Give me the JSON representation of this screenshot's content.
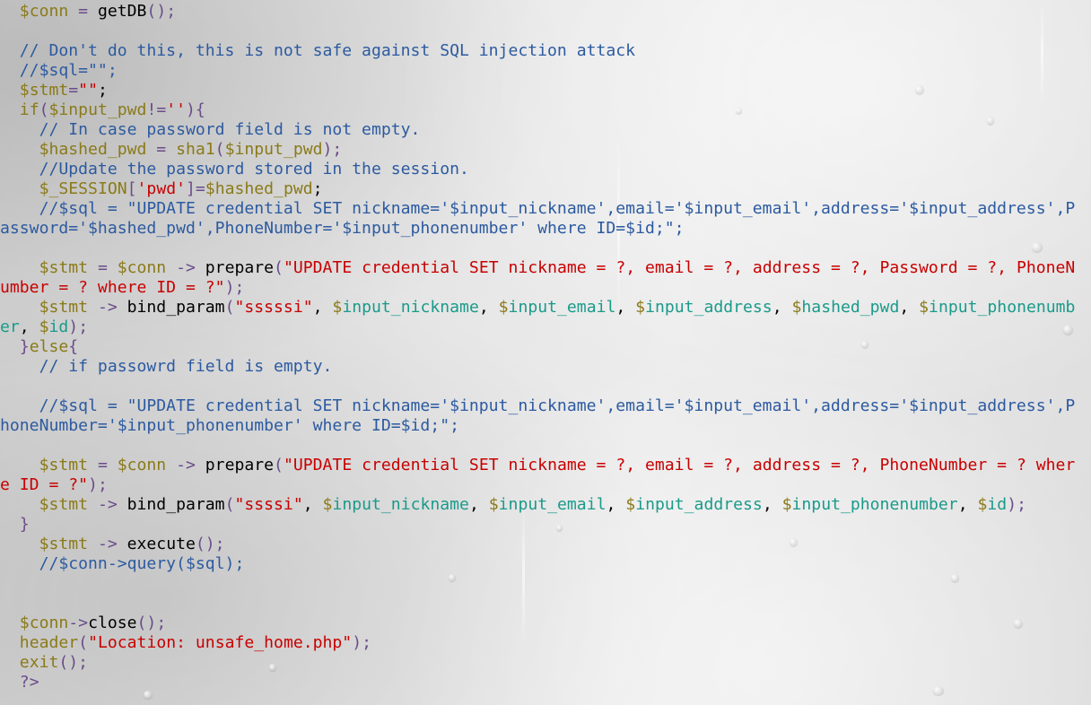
{
  "editor": {
    "lines": [
      [
        {
          "t": "  ",
          "c": ""
        },
        {
          "t": "$conn",
          "c": "var-b"
        },
        {
          "t": " = ",
          "c": "op"
        },
        {
          "t": "getDB",
          "c": "fn"
        },
        {
          "t": "();",
          "c": "op"
        }
      ],
      [],
      [
        {
          "t": "  // Don't do this, this is not safe against SQL injection attack",
          "c": "cm"
        }
      ],
      [
        {
          "t": "  //$sql=\"\";",
          "c": "cm"
        }
      ],
      [
        {
          "t": "  ",
          "c": ""
        },
        {
          "t": "$stmt",
          "c": "var-b"
        },
        {
          "t": "=",
          "c": "op"
        },
        {
          "t": "\"\"",
          "c": "str"
        },
        {
          "t": ";",
          "c": "fn"
        }
      ],
      [
        {
          "t": "  ",
          "c": ""
        },
        {
          "t": "if",
          "c": "kw"
        },
        {
          "t": "(",
          "c": "op"
        },
        {
          "t": "$input_pwd",
          "c": "var-b"
        },
        {
          "t": "!=",
          "c": "op"
        },
        {
          "t": "''",
          "c": "str"
        },
        {
          "t": "){",
          "c": "op"
        }
      ],
      [
        {
          "t": "    // In case password field is not empty.",
          "c": "cm"
        }
      ],
      [
        {
          "t": "    ",
          "c": ""
        },
        {
          "t": "$hashed_pwd",
          "c": "var-b"
        },
        {
          "t": " = ",
          "c": "op"
        },
        {
          "t": "sha1",
          "c": "kw"
        },
        {
          "t": "(",
          "c": "op"
        },
        {
          "t": "$input_pwd",
          "c": "var-b"
        },
        {
          "t": ");",
          "c": "op"
        }
      ],
      [
        {
          "t": "    //Update the password stored in the session.",
          "c": "cm"
        }
      ],
      [
        {
          "t": "    ",
          "c": ""
        },
        {
          "t": "$_SESSION",
          "c": "var-b"
        },
        {
          "t": "[",
          "c": "op"
        },
        {
          "t": "'pwd'",
          "c": "str"
        },
        {
          "t": "]=",
          "c": "op"
        },
        {
          "t": "$hashed_pwd",
          "c": "var-b"
        },
        {
          "t": ";",
          "c": "fn"
        }
      ],
      [
        {
          "t": "    //$sql = \"UPDATE credential SET nickname='$input_nickname',email='$input_email',address='$input_address',P",
          "c": "cm"
        }
      ],
      [
        {
          "t": "assword='$hashed_pwd',PhoneNumber='$input_phonenumber' where ID=$id;\";",
          "c": "cm"
        }
      ],
      [],
      [
        {
          "t": "    ",
          "c": ""
        },
        {
          "t": "$stmt",
          "c": "var-b"
        },
        {
          "t": " = ",
          "c": "op"
        },
        {
          "t": "$conn",
          "c": "var-b"
        },
        {
          "t": " -> ",
          "c": "op"
        },
        {
          "t": "prepare",
          "c": "fn"
        },
        {
          "t": "(",
          "c": "op"
        },
        {
          "t": "\"UPDATE credential SET nickname = ?, email = ?, address = ?, Password = ?, PhoneN",
          "c": "str"
        }
      ],
      [
        {
          "t": "umber = ? where ID = ?\"",
          "c": "str"
        },
        {
          "t": ");",
          "c": "op"
        }
      ],
      [
        {
          "t": "    ",
          "c": ""
        },
        {
          "t": "$stmt",
          "c": "var-b"
        },
        {
          "t": " -> ",
          "c": "op"
        },
        {
          "t": "bind_param",
          "c": "fn"
        },
        {
          "t": "(",
          "c": "op"
        },
        {
          "t": "\"sssssi\"",
          "c": "str"
        },
        {
          "t": ", ",
          "c": "fn"
        },
        {
          "t": "$",
          "c": "var-b"
        },
        {
          "t": "input_nickname",
          "c": "var"
        },
        {
          "t": ", ",
          "c": "fn"
        },
        {
          "t": "$",
          "c": "var-b"
        },
        {
          "t": "input_email",
          "c": "var"
        },
        {
          "t": ", ",
          "c": "fn"
        },
        {
          "t": "$",
          "c": "var-b"
        },
        {
          "t": "input_address",
          "c": "var"
        },
        {
          "t": ", ",
          "c": "fn"
        },
        {
          "t": "$",
          "c": "var-b"
        },
        {
          "t": "hashed_pwd",
          "c": "var"
        },
        {
          "t": ", ",
          "c": "fn"
        },
        {
          "t": "$",
          "c": "var-b"
        },
        {
          "t": "input_phonenumb",
          "c": "var"
        }
      ],
      [
        {
          "t": "er",
          "c": "var"
        },
        {
          "t": ", ",
          "c": "fn"
        },
        {
          "t": "$",
          "c": "var-b"
        },
        {
          "t": "id",
          "c": "var"
        },
        {
          "t": ");",
          "c": "op"
        }
      ],
      [
        {
          "t": "  ",
          "c": ""
        },
        {
          "t": "}",
          "c": "op"
        },
        {
          "t": "else",
          "c": "kw"
        },
        {
          "t": "{",
          "c": "op"
        }
      ],
      [
        {
          "t": "    // if passowrd field is empty.",
          "c": "cm"
        }
      ],
      [],
      [
        {
          "t": "    //$sql = \"UPDATE credential SET nickname='$input_nickname',email='$input_email',address='$input_address',P",
          "c": "cm"
        }
      ],
      [
        {
          "t": "honeNumber='$input_phonenumber' where ID=$id;\";",
          "c": "cm"
        }
      ],
      [],
      [
        {
          "t": "    ",
          "c": ""
        },
        {
          "t": "$stmt",
          "c": "var-b"
        },
        {
          "t": " = ",
          "c": "op"
        },
        {
          "t": "$conn",
          "c": "var-b"
        },
        {
          "t": " -> ",
          "c": "op"
        },
        {
          "t": "prepare",
          "c": "fn"
        },
        {
          "t": "(",
          "c": "op"
        },
        {
          "t": "\"UPDATE credential SET nickname = ?, email = ?, address = ?, PhoneNumber = ? wher",
          "c": "str"
        }
      ],
      [
        {
          "t": "e ID = ?\"",
          "c": "str"
        },
        {
          "t": ");",
          "c": "op"
        }
      ],
      [
        {
          "t": "    ",
          "c": ""
        },
        {
          "t": "$stmt",
          "c": "var-b"
        },
        {
          "t": " -> ",
          "c": "op"
        },
        {
          "t": "bind_param",
          "c": "fn"
        },
        {
          "t": "(",
          "c": "op"
        },
        {
          "t": "\"ssssi\"",
          "c": "str"
        },
        {
          "t": ", ",
          "c": "fn"
        },
        {
          "t": "$",
          "c": "var-b"
        },
        {
          "t": "input_nickname",
          "c": "var"
        },
        {
          "t": ", ",
          "c": "fn"
        },
        {
          "t": "$",
          "c": "var-b"
        },
        {
          "t": "input_email",
          "c": "var"
        },
        {
          "t": ", ",
          "c": "fn"
        },
        {
          "t": "$",
          "c": "var-b"
        },
        {
          "t": "input_address",
          "c": "var"
        },
        {
          "t": ", ",
          "c": "fn"
        },
        {
          "t": "$",
          "c": "var-b"
        },
        {
          "t": "input_phonenumber",
          "c": "var"
        },
        {
          "t": ", ",
          "c": "fn"
        },
        {
          "t": "$",
          "c": "var-b"
        },
        {
          "t": "id",
          "c": "var"
        },
        {
          "t": ");",
          "c": "op"
        }
      ],
      [
        {
          "t": "  ",
          "c": ""
        },
        {
          "t": "}",
          "c": "op"
        }
      ],
      [
        {
          "t": "    ",
          "c": ""
        },
        {
          "t": "$stmt",
          "c": "var-b"
        },
        {
          "t": " -> ",
          "c": "op"
        },
        {
          "t": "execute",
          "c": "fn"
        },
        {
          "t": "();",
          "c": "op"
        }
      ],
      [
        {
          "t": "    //$conn->query($sql);",
          "c": "cm"
        }
      ],
      [],
      [],
      [
        {
          "t": "  ",
          "c": ""
        },
        {
          "t": "$conn",
          "c": "var-b"
        },
        {
          "t": "->",
          "c": "op"
        },
        {
          "t": "close",
          "c": "fn"
        },
        {
          "t": "();",
          "c": "op"
        }
      ],
      [
        {
          "t": "  ",
          "c": ""
        },
        {
          "t": "header",
          "c": "kw"
        },
        {
          "t": "(",
          "c": "op"
        },
        {
          "t": "\"Location: unsafe_home.php\"",
          "c": "str"
        },
        {
          "t": ");",
          "c": "op"
        }
      ],
      [
        {
          "t": "  ",
          "c": ""
        },
        {
          "t": "exit",
          "c": "kw"
        },
        {
          "t": "();",
          "c": "op"
        }
      ],
      [
        {
          "t": "  ",
          "c": ""
        },
        {
          "t": "?>",
          "c": "op"
        }
      ]
    ]
  }
}
